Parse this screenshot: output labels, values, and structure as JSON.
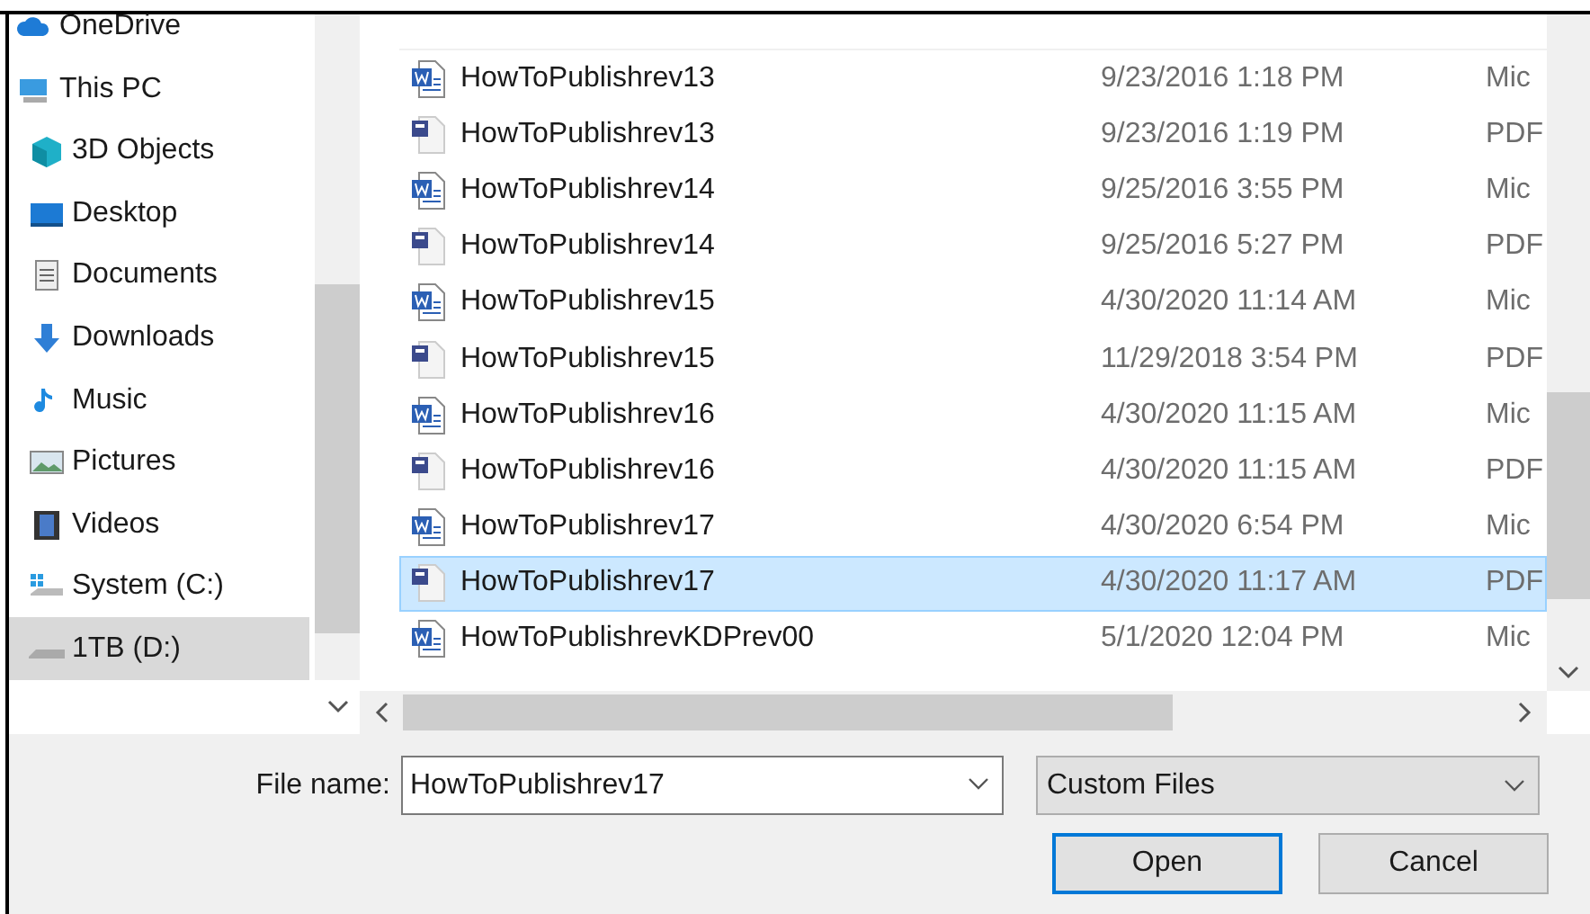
{
  "sidebar": {
    "items": [
      {
        "label": "OneDrive",
        "kind": "cloud",
        "selected": false
      },
      {
        "label": "This PC",
        "kind": "pc",
        "selected": false,
        "children": [
          {
            "label": "3D Objects",
            "kind": "cube",
            "selected": false
          },
          {
            "label": "Desktop",
            "kind": "desktop",
            "selected": false
          },
          {
            "label": "Documents",
            "kind": "documents",
            "selected": false
          },
          {
            "label": "Downloads",
            "kind": "downloads",
            "selected": false
          },
          {
            "label": "Music",
            "kind": "music",
            "selected": false
          },
          {
            "label": "Pictures",
            "kind": "pictures",
            "selected": false
          },
          {
            "label": "Videos",
            "kind": "videos",
            "selected": false
          },
          {
            "label": "System (C:)",
            "kind": "system",
            "selected": false
          },
          {
            "label": "1TB (D:)",
            "kind": "drive",
            "selected": true
          }
        ]
      }
    ]
  },
  "files": [
    {
      "name": "HowToPublishrev13",
      "date": "9/23/2016 1:18 PM",
      "type": "Mic",
      "kind": "word",
      "selected": false
    },
    {
      "name": "HowToPublishrev13",
      "date": "9/23/2016 1:19 PM",
      "type": "PDF",
      "kind": "pdf",
      "selected": false
    },
    {
      "name": "HowToPublishrev14",
      "date": "9/25/2016 3:55 PM",
      "type": "Mic",
      "kind": "word",
      "selected": false
    },
    {
      "name": "HowToPublishrev14",
      "date": "9/25/2016 5:27 PM",
      "type": "PDF",
      "kind": "pdf",
      "selected": false
    },
    {
      "name": "HowToPublishrev15",
      "date": "4/30/2020 11:14 AM",
      "type": "Mic",
      "kind": "word",
      "selected": false
    },
    {
      "name": "HowToPublishrev15",
      "date": "11/29/2018 3:54 PM",
      "type": "PDF",
      "kind": "pdf",
      "selected": false
    },
    {
      "name": "HowToPublishrev16",
      "date": "4/30/2020 11:15 AM",
      "type": "Mic",
      "kind": "word",
      "selected": false
    },
    {
      "name": "HowToPublishrev16",
      "date": "4/30/2020 11:15 AM",
      "type": "PDF",
      "kind": "pdf",
      "selected": false
    },
    {
      "name": "HowToPublishrev17",
      "date": "4/30/2020 6:54 PM",
      "type": "Mic",
      "kind": "word",
      "selected": false
    },
    {
      "name": "HowToPublishrev17",
      "date": "4/30/2020 11:17 AM",
      "type": "PDF",
      "kind": "pdf",
      "selected": true
    },
    {
      "name": "HowToPublishrevKDPrev00",
      "date": "5/1/2020 12:04 PM",
      "type": "Mic",
      "kind": "word",
      "selected": false
    }
  ],
  "file_name": {
    "label": "File name:",
    "value": "HowToPublishrev17"
  },
  "file_type": {
    "value": "Custom Files"
  },
  "buttons": [
    {
      "label": "Open",
      "default": true
    },
    {
      "label": "Cancel",
      "default": false
    }
  ]
}
